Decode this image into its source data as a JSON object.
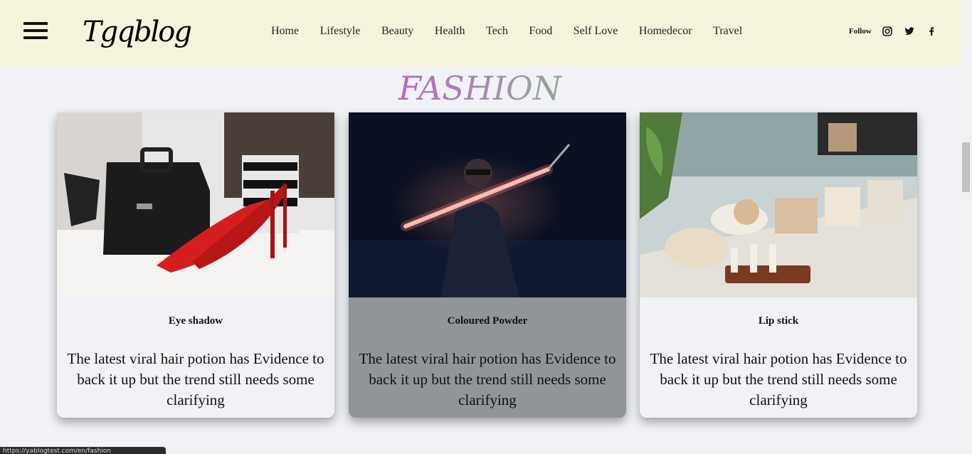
{
  "header": {
    "logo": "Tgqblog",
    "nav": [
      "Home",
      "Lifestyle",
      "Beauty",
      "Health",
      "Tech",
      "Food",
      "Self Love",
      "Homedecor",
      "Travel"
    ],
    "follow_label": "Follow",
    "social": [
      "instagram-icon",
      "twitter-icon",
      "facebook-icon"
    ]
  },
  "section": {
    "title": "FASHION"
  },
  "cards": [
    {
      "title": "Eye shadow",
      "text": "The latest viral hair potion has Evidence to back it up but the trend still needs some clarifying",
      "image": "red-heels-and-black-handbag"
    },
    {
      "title": "Coloured Powder",
      "text": "The latest viral hair potion has Evidence to back it up but the trend still needs some clarifying",
      "image": "person-holding-light-tube"
    },
    {
      "title": "Lip stick",
      "text": "The latest viral hair potion has Evidence to back it up but the trend still needs some clarifying",
      "image": "cosmetic-shop-shelf"
    }
  ],
  "status_bar": {
    "url": "https://yablogtest.com/en/fashion"
  },
  "colors": {
    "header_bg": "#f4f4dc",
    "page_bg": "#f1f2f6",
    "active_card_bg": "#8f9598"
  }
}
